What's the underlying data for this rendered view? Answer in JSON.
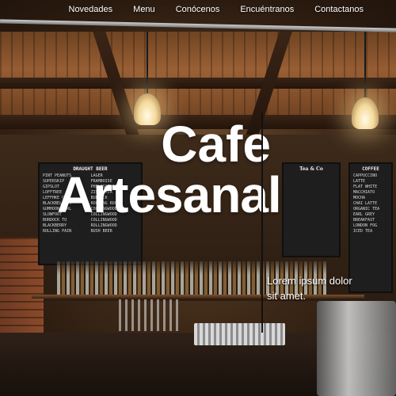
{
  "nav": {
    "items": [
      {
        "label": "Novedades"
      },
      {
        "label": "Menu"
      },
      {
        "label": "Conócenos"
      },
      {
        "label": "Encuéntranos"
      },
      {
        "label": "Contactanos"
      }
    ]
  },
  "hero": {
    "title_line1": "Cafe",
    "title_line2": "Artesanal",
    "tagline": "Lorem ipsum dolor sit amet."
  },
  "background": {
    "boards": {
      "left": {
        "title": "DRAUGHT BEER",
        "col1": [
          "PINT PEANUTS",
          "SUPERSKIP",
          "GIPSLOT",
          "LOFFTREE",
          "LEFFHKE CHAI",
          "BLACKBELLOWS",
          "GUMHOON EARL",
          "SLOWFOOT",
          "BURDOCK TO",
          "BLACKBERRY",
          "ROLLING PAIN"
        ],
        "col2": [
          "LAGER",
          "FRAMBOISE",
          "PHILOSOPHIE",
          "ZISSE TEA",
          "BURDOCK",
          "ROLLING ROCK",
          "COLLINGWOOD",
          "COLLINGWOOD",
          "COLLINGWOOD",
          "ROLLINGWOOD",
          "BUSH BEER"
        ]
      },
      "center": {
        "title": "Tea & Co"
      },
      "right": {
        "title": "COFFEE",
        "items": [
          "CAPPUCCINO",
          "LATTE",
          "FLAT WHITE",
          "MACCHIATO",
          "MOCHA",
          "CHAI LATTE",
          "ORGANIC TEA",
          "EARL GREY",
          "BREAKFAST",
          "LONDON FOG",
          "ICED TEA"
        ]
      }
    }
  },
  "colors": {
    "text": "#ffffff",
    "divider": "#111111",
    "wood": "#a8683a"
  }
}
